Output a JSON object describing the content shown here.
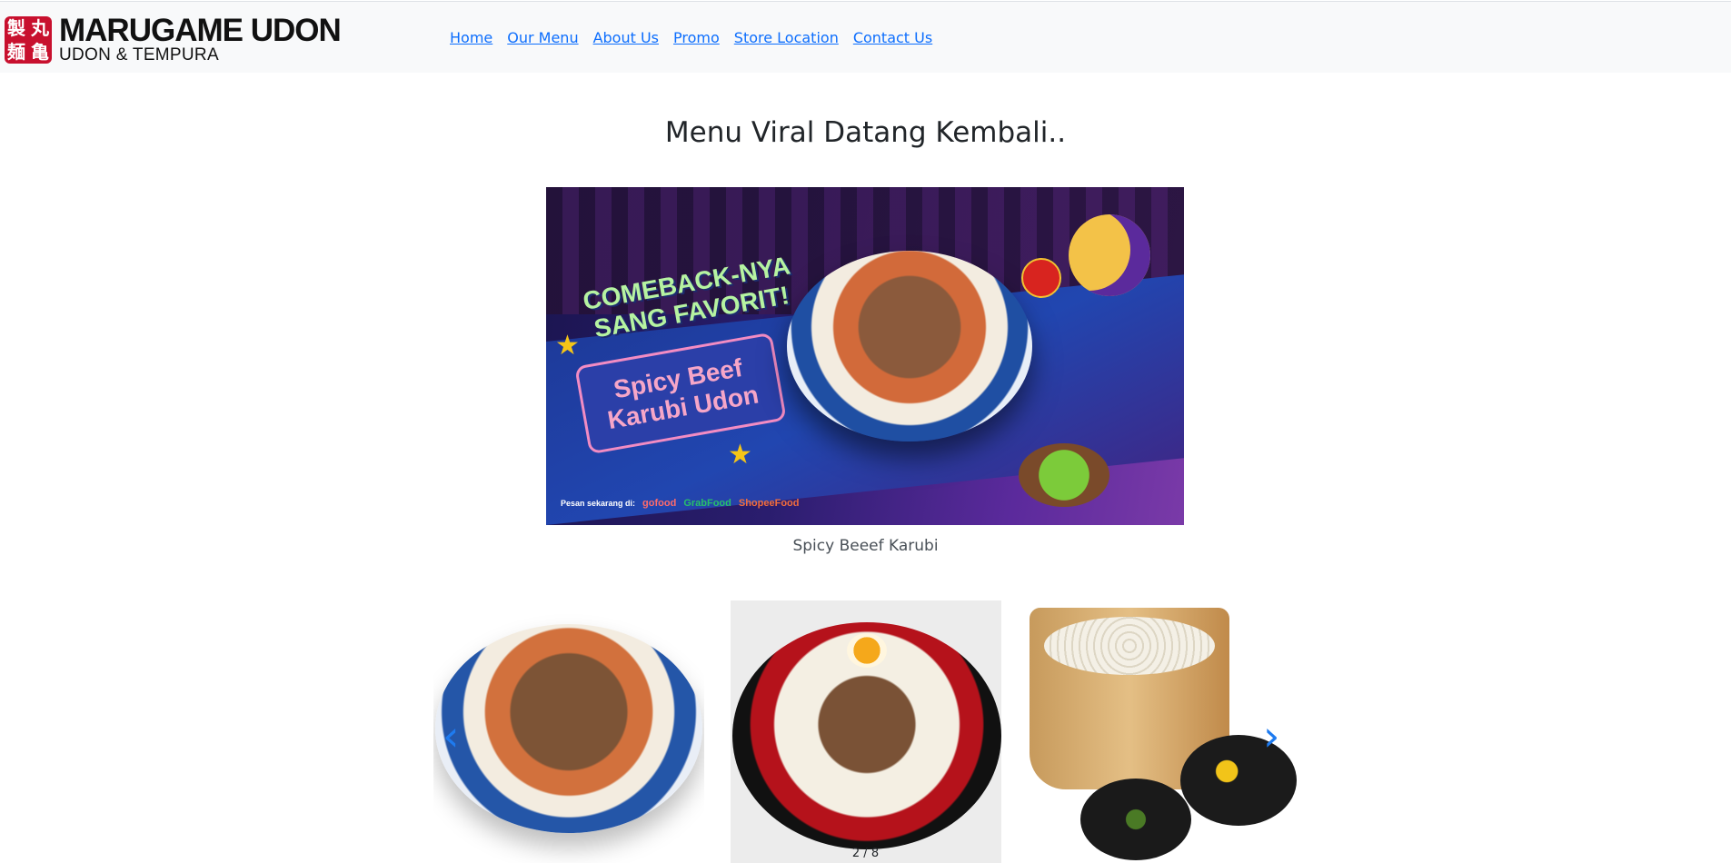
{
  "brand": {
    "seal_chars": [
      "製",
      "丸",
      "麺",
      "亀"
    ],
    "name": "MARUGAME UDON",
    "tagline": "UDON & TEMPURA"
  },
  "nav": {
    "links": [
      "Home",
      "Our Menu",
      "About Us",
      "Promo",
      "Store Location",
      "Contact Us"
    ]
  },
  "hero": {
    "title": "Menu Viral Datang Kembali..",
    "banner": {
      "headline_1": "COMEBACK-NYA",
      "headline_2": "SANG FAVORIT!",
      "product_1": "Spicy Beef",
      "product_2": "Karubi Udon",
      "order_prefix": "Pesan sekarang di:",
      "partners": [
        "gofood",
        "GrabFood",
        "ShopeeFood"
      ]
    },
    "caption": "Spicy Beeef Karubi"
  },
  "carousel": {
    "counter": "2 / 8",
    "prev_icon": "chevron-left-icon",
    "next_icon": "chevron-right-icon"
  },
  "colors": {
    "nav_bg": "#f8f9fa",
    "link": "#0d6efd",
    "carousel_arrow": "#1e7bf0",
    "brand_red": "#c8102e"
  }
}
